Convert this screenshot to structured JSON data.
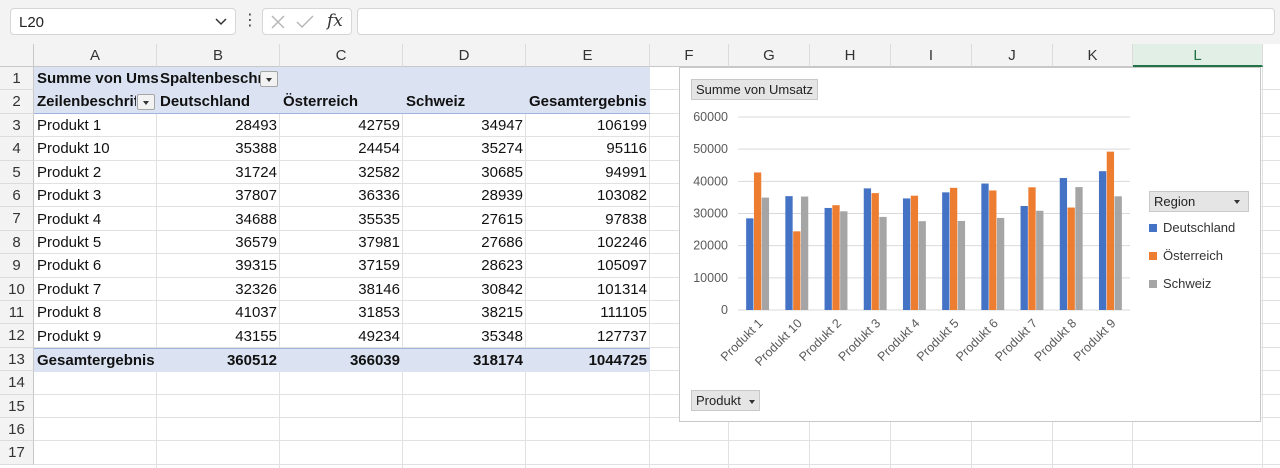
{
  "formula_bar": {
    "name_box": "L20",
    "fx_label": "fx",
    "formula": ""
  },
  "columns": [
    "A",
    "B",
    "C",
    "D",
    "E",
    "F",
    "G",
    "H",
    "I",
    "J",
    "K",
    "L"
  ],
  "selected_column": "L",
  "rows": [
    "1",
    "2",
    "3",
    "4",
    "5",
    "6",
    "7",
    "8",
    "9",
    "10",
    "11",
    "12",
    "13",
    "14",
    "15",
    "16",
    "17"
  ],
  "pivot": {
    "a1": "Summe von Umsatz",
    "b1": "Spaltenbeschriftungen",
    "row_label_header": "Zeilenbeschriftungen",
    "col_headers": [
      "Deutschland",
      "Österreich",
      "Schweiz",
      "Gesamtergebnis"
    ],
    "body": [
      {
        "label": "Produkt 1",
        "values": [
          "28493",
          "42759",
          "34947",
          "106199"
        ]
      },
      {
        "label": "Produkt 10",
        "values": [
          "35388",
          "24454",
          "35274",
          "95116"
        ]
      },
      {
        "label": "Produkt 2",
        "values": [
          "31724",
          "32582",
          "30685",
          "94991"
        ]
      },
      {
        "label": "Produkt 3",
        "values": [
          "37807",
          "36336",
          "28939",
          "103082"
        ]
      },
      {
        "label": "Produkt 4",
        "values": [
          "34688",
          "35535",
          "27615",
          "97838"
        ]
      },
      {
        "label": "Produkt 5",
        "values": [
          "36579",
          "37981",
          "27686",
          "102246"
        ]
      },
      {
        "label": "Produkt 6",
        "values": [
          "39315",
          "37159",
          "28623",
          "105097"
        ]
      },
      {
        "label": "Produkt 7",
        "values": [
          "32326",
          "38146",
          "30842",
          "101314"
        ]
      },
      {
        "label": "Produkt 8",
        "values": [
          "41037",
          "31853",
          "38215",
          "111105"
        ]
      },
      {
        "label": "Produkt 9",
        "values": [
          "43155",
          "49234",
          "35348",
          "127737"
        ]
      }
    ],
    "total": {
      "label": "Gesamtergebnis",
      "values": [
        "360512",
        "366039",
        "318174",
        "1044725"
      ]
    }
  },
  "chart": {
    "value_button": "Summe von Umsatz",
    "axis_button": "Produkt",
    "legend_title": "Region",
    "legend_items": [
      "Deutschland",
      "Österreich",
      "Schweiz"
    ],
    "y_ticks": [
      "60000",
      "50000",
      "40000",
      "30000",
      "20000",
      "10000",
      "0"
    ]
  },
  "chart_data": {
    "type": "bar",
    "categories": [
      "Produkt 1",
      "Produkt 10",
      "Produkt 2",
      "Produkt 3",
      "Produkt 4",
      "Produkt 5",
      "Produkt 6",
      "Produkt 7",
      "Produkt 8",
      "Produkt 9"
    ],
    "series": [
      {
        "name": "Deutschland",
        "color": "#4472c4",
        "values": [
          28493,
          35388,
          31724,
          37807,
          34688,
          36579,
          39315,
          32326,
          41037,
          43155
        ]
      },
      {
        "name": "Österreich",
        "color": "#ed7d31",
        "values": [
          42759,
          24454,
          32582,
          36336,
          35535,
          37981,
          37159,
          38146,
          31853,
          49234
        ]
      },
      {
        "name": "Schweiz",
        "color": "#a5a5a5",
        "values": [
          34947,
          35274,
          30685,
          28939,
          27615,
          27686,
          28623,
          30842,
          38215,
          35348
        ]
      }
    ],
    "ylim": [
      0,
      60000
    ],
    "grid": true,
    "legend": "right"
  }
}
